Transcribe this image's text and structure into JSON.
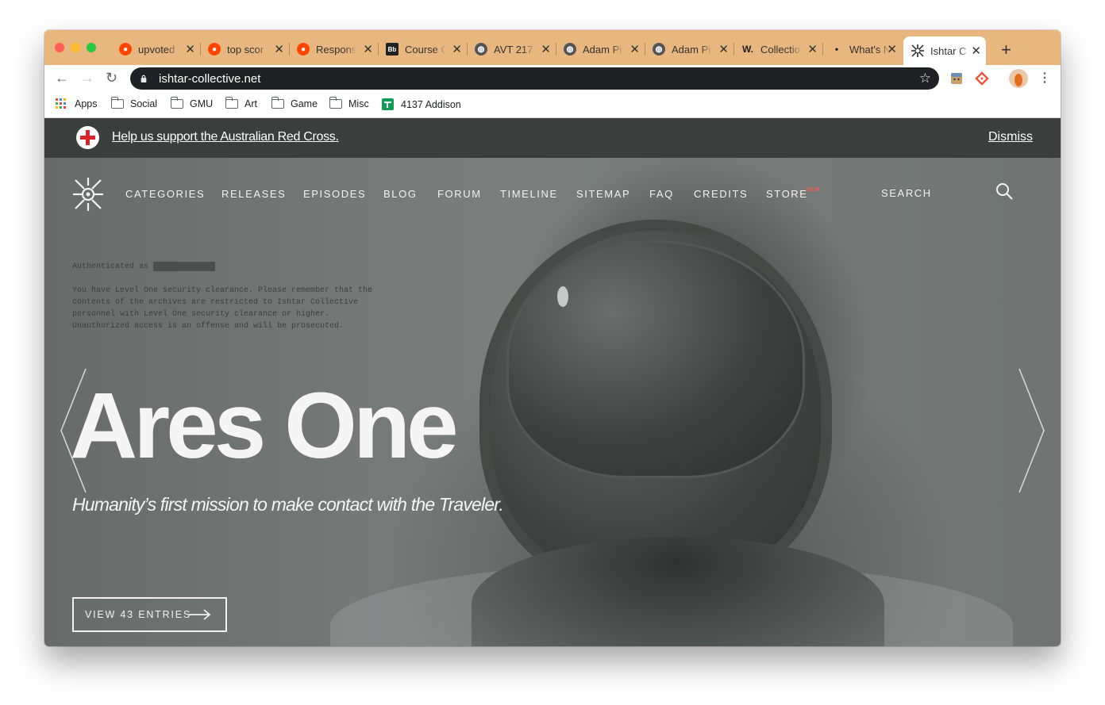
{
  "tabs": [
    {
      "label": "upvoted",
      "icon": "reddit-icon"
    },
    {
      "label": "top scor",
      "icon": "reddit-icon"
    },
    {
      "label": "Respons",
      "icon": "reddit-icon"
    },
    {
      "label": "Course C",
      "icon": "blackboard-icon",
      "icon_text": "Bb"
    },
    {
      "label": "AVT 217",
      "icon": "globe-icon"
    },
    {
      "label": "Adam Pi",
      "icon": "globe-icon"
    },
    {
      "label": "Adam Pi",
      "icon": "globe-icon"
    },
    {
      "label": "Collectio",
      "icon": "wikia-icon",
      "icon_text": "W."
    },
    {
      "label": "What's N",
      "icon": "dot-icon",
      "icon_text": "•"
    },
    {
      "label": "Ishtar C",
      "icon": "ishtar-icon",
      "active": true
    }
  ],
  "toolbar": {
    "url": "ishtar-collective.net"
  },
  "bookmarks": [
    {
      "label": "Apps",
      "icon": "apps-grid-icon"
    },
    {
      "label": "Social",
      "icon": "folder-icon"
    },
    {
      "label": "GMU",
      "icon": "folder-icon"
    },
    {
      "label": "Art",
      "icon": "folder-icon"
    },
    {
      "label": "Game",
      "icon": "folder-icon"
    },
    {
      "label": "Misc",
      "icon": "folder-icon"
    },
    {
      "label": "4137 Addison",
      "icon": "sheets-icon"
    }
  ],
  "banner": {
    "link_text": "Help us support the Australian Red Cross.",
    "dismiss": "Dismiss"
  },
  "nav": {
    "items": [
      "CATEGORIES",
      "RELEASES",
      "EPISODES",
      "BLOG",
      "FORUM",
      "TIMELINE",
      "SITEMAP",
      "FAQ",
      "CREDITS",
      "STORE"
    ],
    "store_badge": "NEW",
    "search_label": "SEARCH"
  },
  "terminal": {
    "auth_label": "Authenticated as",
    "lines": [
      "You have Level One security clearance. Please remember that the",
      "contents of the archives are restricted to Ishtar Collective",
      "personnel with Level One security clearance or higher.",
      "Unauthorized access is an offense and will be prosecuted."
    ]
  },
  "hero": {
    "title": "Ares One",
    "subtitle": "Humanity’s first mission to make contact with the Traveler.",
    "cta": "VIEW 43 ENTRIES"
  },
  "colors": {
    "tabstrip": "#e8b780",
    "banner": "#3a3f3e",
    "omnibox": "#202124",
    "red_cross": "#d8232a",
    "new_badge": "#ff5a4a"
  }
}
